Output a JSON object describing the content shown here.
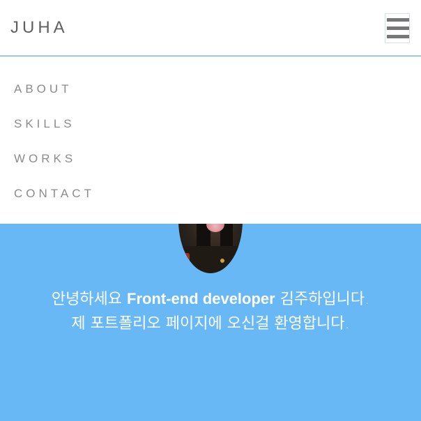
{
  "header": {
    "brand": "JUHA",
    "menu_button_icon": "hamburger-menu-icon"
  },
  "nav": {
    "items": [
      {
        "label": "ABOUT"
      },
      {
        "label": "SKILLS"
      },
      {
        "label": "WORKS"
      },
      {
        "label": "CONTACT"
      }
    ]
  },
  "hero": {
    "background_color": "#67b8f4",
    "greeting_prefix": "안녕하세요 ",
    "greeting_role": "Front-end developer",
    "greeting_suffix": " 김주하입니다.",
    "greeting_line2": "제 포트폴리오 페이지에 오신걸 환영합니다."
  }
}
